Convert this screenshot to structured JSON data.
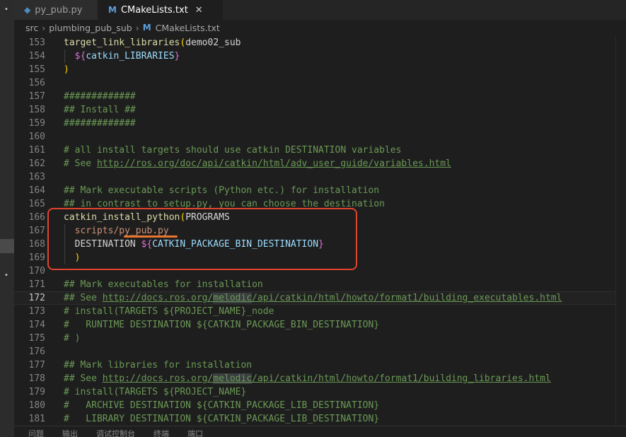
{
  "tabs": [
    {
      "label": "py_pub.py",
      "icon": "python-icon"
    },
    {
      "label": "CMakeLists.txt",
      "icon": "cmake-icon",
      "active": true
    }
  ],
  "breadcrumb": {
    "parts": [
      "src",
      "plumbing_pub_sub",
      "CMakeLists.txt"
    ]
  },
  "lines": [
    {
      "n": "153",
      "t": [
        [
          "f",
          "target_link_libraries"
        ],
        [
          "p",
          "("
        ],
        [
          "k",
          "demo02_sub"
        ]
      ]
    },
    {
      "n": "154",
      "t": [
        [
          "k",
          "  "
        ],
        [
          "pb",
          "${"
        ],
        [
          "v",
          "catkin_LIBRARIES"
        ],
        [
          "pb",
          "}"
        ]
      ]
    },
    {
      "n": "155",
      "t": [
        [
          "p",
          ")"
        ]
      ]
    },
    {
      "n": "156",
      "t": []
    },
    {
      "n": "157",
      "t": [
        [
          "c",
          "#############"
        ]
      ]
    },
    {
      "n": "158",
      "t": [
        [
          "c",
          "## Install ##"
        ]
      ]
    },
    {
      "n": "159",
      "t": [
        [
          "c",
          "#############"
        ]
      ]
    },
    {
      "n": "160",
      "t": []
    },
    {
      "n": "161",
      "t": [
        [
          "c",
          "# all install targets should use catkin DESTINATION variables"
        ]
      ]
    },
    {
      "n": "162",
      "t": [
        [
          "c",
          "# See "
        ],
        [
          "u",
          "http://ros.org/doc/api/catkin/html/adv_user_guide/variables.html"
        ]
      ]
    },
    {
      "n": "163",
      "t": []
    },
    {
      "n": "164",
      "t": [
        [
          "c",
          "## Mark executable scripts (Python etc.) for installation"
        ]
      ]
    },
    {
      "n": "165",
      "t": [
        [
          "c",
          "## in contrast to setup.py, you can choose the destination"
        ]
      ]
    },
    {
      "n": "166",
      "t": [
        [
          "f",
          "catkin_install_python"
        ],
        [
          "p",
          "("
        ],
        [
          "k",
          "PROGRAMS"
        ]
      ]
    },
    {
      "n": "167",
      "t": [
        [
          "k",
          "  "
        ],
        [
          "s",
          "scripts/py_pub.py"
        ]
      ]
    },
    {
      "n": "168",
      "t": [
        [
          "k",
          "  DESTINATION "
        ],
        [
          "pb",
          "${"
        ],
        [
          "v",
          "CATKIN_PACKAGE_BIN_DESTINATION"
        ],
        [
          "pb",
          "}"
        ]
      ]
    },
    {
      "n": "169",
      "t": [
        [
          "k",
          "  "
        ],
        [
          "p",
          ")"
        ]
      ]
    },
    {
      "n": "170",
      "t": []
    },
    {
      "n": "171",
      "t": [
        [
          "c",
          "## Mark executables for installation"
        ]
      ]
    },
    {
      "n": "172",
      "t": [
        [
          "c",
          "## See "
        ],
        [
          "u",
          "http://docs.ros.org/"
        ],
        [
          "uh",
          "melodic"
        ],
        [
          "u",
          "/api/catkin/html/howto/format1/building_executables.html"
        ]
      ],
      "active": true
    },
    {
      "n": "173",
      "t": [
        [
          "c",
          "# install(TARGETS ${PROJECT_NAME}_node"
        ]
      ]
    },
    {
      "n": "174",
      "t": [
        [
          "c",
          "#   RUNTIME DESTINATION ${CATKIN_PACKAGE_BIN_DESTINATION}"
        ]
      ]
    },
    {
      "n": "175",
      "t": [
        [
          "c",
          "# )"
        ]
      ]
    },
    {
      "n": "176",
      "t": []
    },
    {
      "n": "177",
      "t": [
        [
          "c",
          "## Mark libraries for installation"
        ]
      ]
    },
    {
      "n": "178",
      "t": [
        [
          "c",
          "## See "
        ],
        [
          "u",
          "http://docs.ros.org/"
        ],
        [
          "uh",
          "melodic"
        ],
        [
          "u",
          "/api/catkin/html/howto/format1/building_libraries.html"
        ]
      ]
    },
    {
      "n": "179",
      "t": [
        [
          "c",
          "# install(TARGETS ${PROJECT_NAME}"
        ]
      ]
    },
    {
      "n": "180",
      "t": [
        [
          "c",
          "#   ARCHIVE DESTINATION ${CATKIN_PACKAGE_LIB_DESTINATION}"
        ]
      ]
    },
    {
      "n": "181",
      "t": [
        [
          "c",
          "#   LIBRARY DESTINATION ${CATKIN_PACKAGE_LIB_DESTINATION}"
        ]
      ]
    }
  ],
  "panel_tabs": [
    "问题",
    "输出",
    "调试控制台",
    "终端",
    "端口"
  ],
  "colors": {
    "annotation_box": "#e0452e",
    "annotation_underline": "#e8772e",
    "comment": "#6a9955"
  }
}
